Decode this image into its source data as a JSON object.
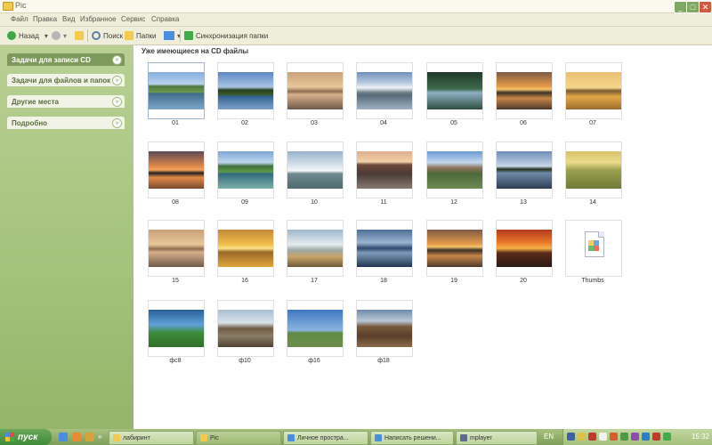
{
  "window": {
    "title": "Pic"
  },
  "menu": [
    "Файл",
    "Правка",
    "Вид",
    "Избранное",
    "Сервис",
    "Справка"
  ],
  "toolbar": {
    "back": "Назад",
    "search": "Поиск",
    "folders": "Папки",
    "sync": "Синхронизация папки"
  },
  "sidebar": {
    "panes": [
      {
        "label": "Задачи для записи CD",
        "state": "dark"
      },
      {
        "label": "Задачи для файлов и папок",
        "state": "light"
      },
      {
        "label": "Другие места",
        "state": "light"
      },
      {
        "label": "Подробно",
        "state": "light"
      }
    ]
  },
  "content": {
    "heading": "Уже имеющиеся на CD файлы",
    "files": [
      {
        "name": "01",
        "kind": "mountain"
      },
      {
        "name": "02",
        "kind": "pines"
      },
      {
        "name": "03",
        "kind": "dusk"
      },
      {
        "name": "04",
        "kind": "snow"
      },
      {
        "name": "05",
        "kind": "forest"
      },
      {
        "name": "06",
        "kind": "sunset"
      },
      {
        "name": "07",
        "kind": "golden"
      },
      {
        "name": "08",
        "kind": "orange"
      },
      {
        "name": "09",
        "kind": "greenmt"
      },
      {
        "name": "10",
        "kind": "mist"
      },
      {
        "name": "11",
        "kind": "peaks"
      },
      {
        "name": "12",
        "kind": "alpine"
      },
      {
        "name": "13",
        "kind": "lake"
      },
      {
        "name": "14",
        "kind": "haze"
      },
      {
        "name": "15",
        "kind": "dusk"
      },
      {
        "name": "16",
        "kind": "sail"
      },
      {
        "name": "17",
        "kind": "canoe"
      },
      {
        "name": "18",
        "kind": "blue"
      },
      {
        "name": "19",
        "kind": "sunset"
      },
      {
        "name": "20",
        "kind": "desert"
      },
      {
        "name": "Thumbs",
        "kind": "file"
      },
      {
        "name": "фс8",
        "kind": "flower"
      },
      {
        "name": "ф10",
        "kind": "marsh"
      },
      {
        "name": "ф16",
        "kind": "field"
      },
      {
        "name": "ф18",
        "kind": "wood"
      }
    ]
  },
  "taskbar": {
    "start": "пуск",
    "tasks": [
      {
        "label": "лабиринт",
        "color": "#f3c94f"
      },
      {
        "label": "Pic",
        "color": "#f3c94f",
        "active": true
      },
      {
        "label": "Личное простра...",
        "color": "#4b8ee0"
      },
      {
        "label": "Написать решени...",
        "color": "#4b8ee0"
      },
      {
        "label": "mplayer",
        "color": "#5e6b8a"
      }
    ],
    "lang": "EN",
    "clock": "15:32"
  }
}
